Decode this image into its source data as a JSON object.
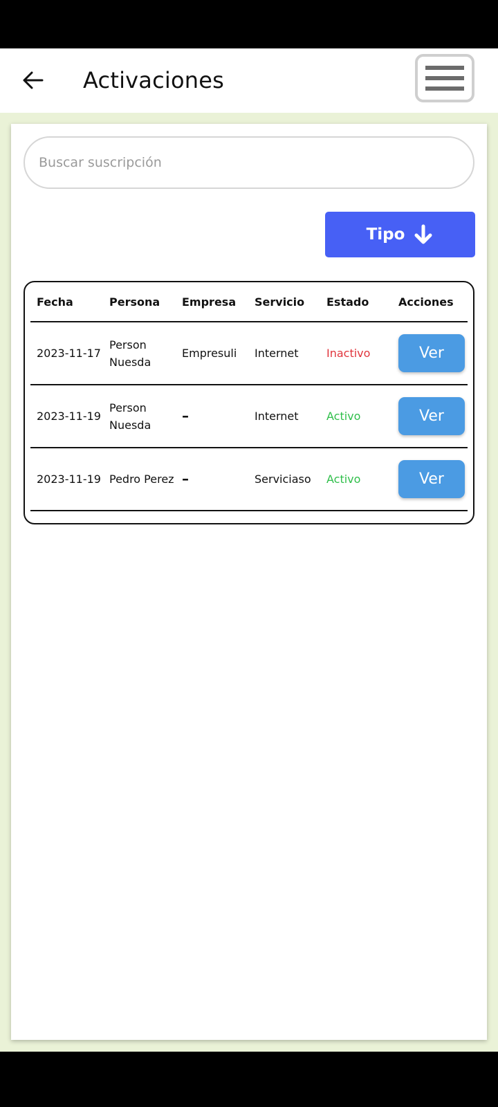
{
  "header": {
    "title": "Activaciones",
    "back_icon": "arrow-left-icon",
    "menu_icon": "hamburger-menu-icon"
  },
  "search": {
    "placeholder": "Buscar suscripción",
    "value": ""
  },
  "filter": {
    "label": "Tipo",
    "icon": "arrow-down-icon"
  },
  "table": {
    "columns": [
      "Fecha",
      "Persona",
      "Empresa",
      "Servicio",
      "Estado",
      "Acciones"
    ],
    "rows": [
      {
        "fecha": "2023-11-17",
        "persona": "Person Nuesda",
        "empresa": "Empresuli",
        "servicio": "Internet",
        "estado": "Inactivo",
        "accion": "Ver"
      },
      {
        "fecha": "2023-11-19",
        "persona": "Person Nuesda",
        "empresa": "–",
        "servicio": "Internet",
        "estado": "Activo",
        "accion": "Ver"
      },
      {
        "fecha": "2023-11-19",
        "persona": "Pedro Perez",
        "empresa": "–",
        "servicio": "Serviciaso",
        "estado": "Activo",
        "accion": "Ver"
      }
    ]
  },
  "colors": {
    "accent_blue": "#4760f5",
    "button_blue": "#4b9be3",
    "inactive_red": "#e0343c",
    "active_green": "#2fbf4a",
    "background": "#eaf2d7"
  }
}
